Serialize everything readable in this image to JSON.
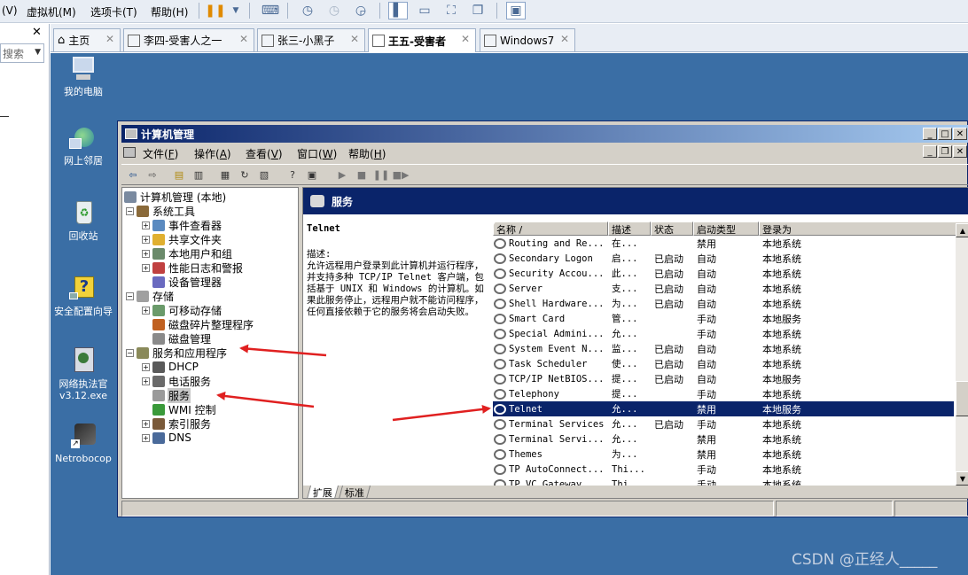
{
  "vm_menubar": {
    "items": [
      "(V)",
      "虚拟机(M)",
      "选项卡(T)",
      "帮助(H)"
    ]
  },
  "vm_left": {
    "close": "✕",
    "search_placeholder": "搜索"
  },
  "vm_tabs": [
    {
      "label": "主页",
      "icon": "home-icon"
    },
    {
      "label": "李四-受害人之一",
      "icon": "vm-icon"
    },
    {
      "label": "张三-小黑子",
      "icon": "vm-icon"
    },
    {
      "label": "王五-受害者",
      "icon": "vm-icon",
      "active": true
    },
    {
      "label": "Windows7",
      "icon": "vm-icon"
    }
  ],
  "desktop_icons": [
    {
      "label": "我的电脑",
      "icon": "my-computer-icon"
    },
    {
      "label": "网上邻居",
      "icon": "network-places-icon"
    },
    {
      "label": "回收站",
      "icon": "recycle-bin-icon"
    },
    {
      "label": "安全配置向导",
      "icon": "security-wizard-icon"
    },
    {
      "label": "网络执法官\nv3.12.exe",
      "label_l1": "网络执法官",
      "label_l2": "v3.12.exe",
      "icon": "network-tool-icon"
    },
    {
      "label": "Netrobocop",
      "icon": "netrobocop-icon"
    }
  ],
  "cm_window": {
    "title": "计算机管理",
    "menu": [
      "文件(F)",
      "操作(A)",
      "查看(V)",
      "窗口(W)",
      "帮助(H)"
    ],
    "menu_display": [
      {
        "text": "文件",
        "key": "F"
      },
      {
        "text": "操作",
        "key": "A"
      },
      {
        "text": "查看",
        "key": "V"
      },
      {
        "text": "窗口",
        "key": "W"
      },
      {
        "text": "帮助",
        "key": "H"
      }
    ]
  },
  "tree": [
    {
      "label": "计算机管理 (本地)",
      "level": 0,
      "expander": ""
    },
    {
      "label": "系统工具",
      "level": 1,
      "expander": "−"
    },
    {
      "label": "事件查看器",
      "level": 2,
      "expander": "+"
    },
    {
      "label": "共享文件夹",
      "level": 2,
      "expander": "+"
    },
    {
      "label": "本地用户和组",
      "level": 2,
      "expander": "+"
    },
    {
      "label": "性能日志和警报",
      "level": 2,
      "expander": "+"
    },
    {
      "label": "设备管理器",
      "level": 2,
      "expander": ""
    },
    {
      "label": "存储",
      "level": 1,
      "expander": "−"
    },
    {
      "label": "可移动存储",
      "level": 2,
      "expander": "+"
    },
    {
      "label": "磁盘碎片整理程序",
      "level": 2,
      "expander": ""
    },
    {
      "label": "磁盘管理",
      "level": 2,
      "expander": ""
    },
    {
      "label": "服务和应用程序",
      "level": 1,
      "expander": "−"
    },
    {
      "label": "DHCP",
      "level": 2,
      "expander": "+"
    },
    {
      "label": "电话服务",
      "level": 2,
      "expander": "+"
    },
    {
      "label": "服务",
      "level": 2,
      "expander": "",
      "selected": true
    },
    {
      "label": "WMI 控制",
      "level": 2,
      "expander": ""
    },
    {
      "label": "索引服务",
      "level": 2,
      "expander": "+"
    },
    {
      "label": "DNS",
      "level": 2,
      "expander": "+"
    }
  ],
  "right_pane": {
    "header": "服务",
    "desc_title": "Telnet",
    "desc_label": "描述:",
    "desc_text": "允许远程用户登录到此计算机并运行程序，并支持多种 TCP/IP Telnet 客户端，包括基于 UNIX 和 Windows 的计算机。如果此服务停止，远程用户就不能访问程序，任何直接依赖于它的服务将会启动失败。",
    "columns": [
      "名称  /",
      "描述",
      "状态",
      "启动类型",
      "登录为"
    ],
    "rows": [
      {
        "name": "Routing and Re...",
        "desc": "在...",
        "status": "",
        "startup": "禁用",
        "logon": "本地系统"
      },
      {
        "name": "Secondary Logon",
        "desc": "启...",
        "status": "已启动",
        "startup": "自动",
        "logon": "本地系统"
      },
      {
        "name": "Security Accou...",
        "desc": "此...",
        "status": "已启动",
        "startup": "自动",
        "logon": "本地系统"
      },
      {
        "name": "Server",
        "desc": "支...",
        "status": "已启动",
        "startup": "自动",
        "logon": "本地系统"
      },
      {
        "name": "Shell Hardware...",
        "desc": "为...",
        "status": "已启动",
        "startup": "自动",
        "logon": "本地系统"
      },
      {
        "name": "Smart Card",
        "desc": "管...",
        "status": "",
        "startup": "手动",
        "logon": "本地服务"
      },
      {
        "name": "Special Admini...",
        "desc": "允...",
        "status": "",
        "startup": "手动",
        "logon": "本地系统"
      },
      {
        "name": "System Event N...",
        "desc": "监...",
        "status": "已启动",
        "startup": "自动",
        "logon": "本地系统"
      },
      {
        "name": "Task Scheduler",
        "desc": "使...",
        "status": "已启动",
        "startup": "自动",
        "logon": "本地系统"
      },
      {
        "name": "TCP/IP NetBIOS...",
        "desc": "提...",
        "status": "已启动",
        "startup": "自动",
        "logon": "本地服务"
      },
      {
        "name": "Telephony",
        "desc": "提...",
        "status": "",
        "startup": "手动",
        "logon": "本地系统"
      },
      {
        "name": "Telnet",
        "desc": "允...",
        "status": "",
        "startup": "禁用",
        "logon": "本地服务",
        "selected": true
      },
      {
        "name": "Terminal Services",
        "desc": "允...",
        "status": "已启动",
        "startup": "手动",
        "logon": "本地系统"
      },
      {
        "name": "Terminal Servi...",
        "desc": "允...",
        "status": "",
        "startup": "禁用",
        "logon": "本地系统"
      },
      {
        "name": "Themes",
        "desc": "为...",
        "status": "",
        "startup": "禁用",
        "logon": "本地系统"
      },
      {
        "name": "TP AutoConnect...",
        "desc": "Thi...",
        "status": "",
        "startup": "手动",
        "logon": "本地系统"
      },
      {
        "name": "TP VC Gateway...",
        "desc": "Thi...",
        "status": "",
        "startup": "手动",
        "logon": "本地系统"
      }
    ],
    "tabs": [
      "扩展",
      "标准"
    ]
  },
  "watermark": "CSDN @正经人_____",
  "colors": {
    "desktop": "#3a6ea5",
    "title_active": "#0a246a",
    "annotation_arrow": "#e02020"
  }
}
